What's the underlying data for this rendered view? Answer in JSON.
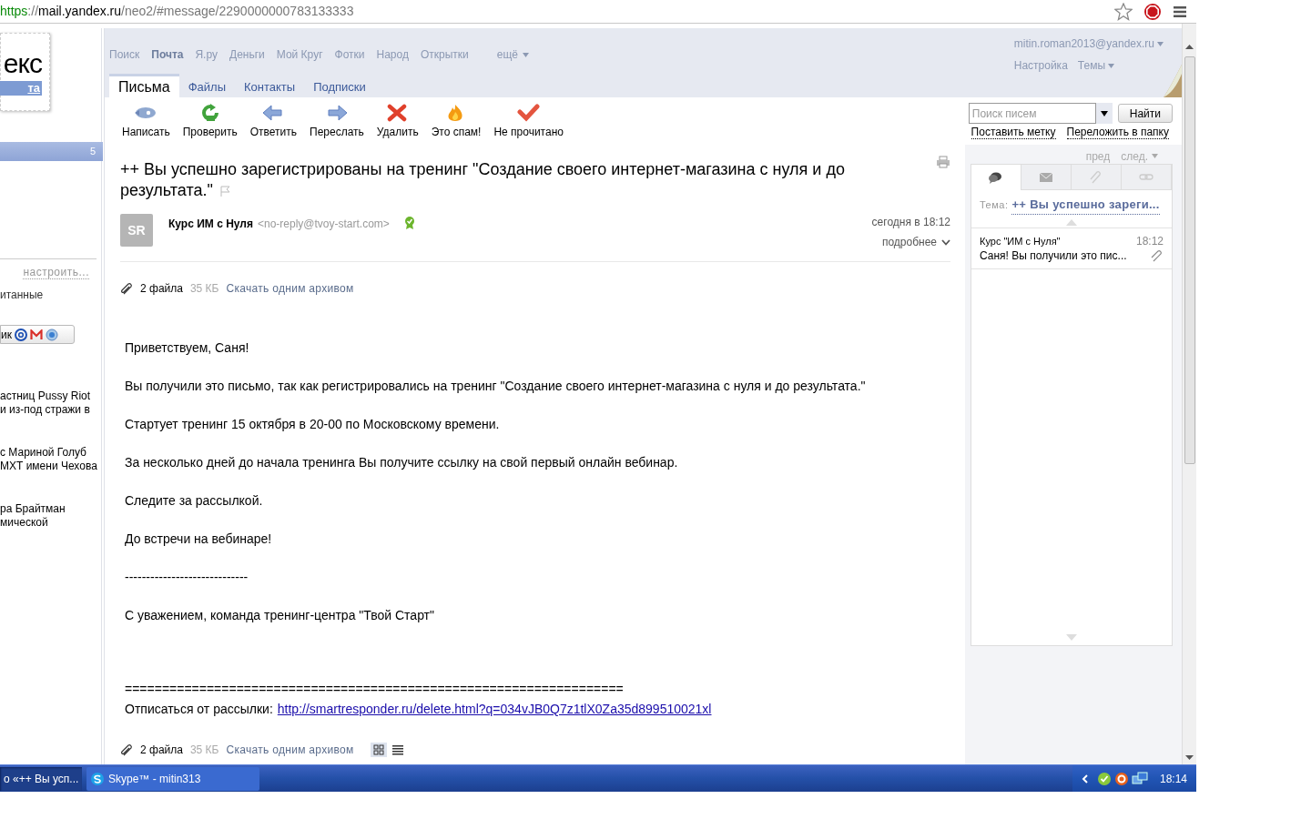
{
  "browser": {
    "url_parts": [
      {
        "kind": "scheme",
        "text": "https"
      },
      {
        "kind": "dim",
        "text": "://"
      },
      {
        "kind": "host",
        "text": "mail.yandex.ru"
      },
      {
        "kind": "dim",
        "text": "/neo2/#message/2290000000783133333"
      }
    ]
  },
  "sidebar": {
    "logo_text": "екс",
    "logo_sub": "та",
    "folder_count": "5",
    "configure_link": "настроить...",
    "folder_item": "итанные",
    "import_button": "ик",
    "news": [
      {
        "lines": [
          "астниц Pussy Riot",
          "и из-под стражи в"
        ]
      },
      {
        "lines": [
          "с Мариной Голуб",
          "МХТ имени Чехова"
        ]
      },
      {
        "lines": [
          "ра Брайтман",
          "мической"
        ]
      }
    ]
  },
  "services": [
    {
      "label": "Поиск",
      "selected": false
    },
    {
      "label": "Почта",
      "selected": true
    },
    {
      "label": "Я.ру",
      "selected": false
    },
    {
      "label": "Деньги",
      "selected": false
    },
    {
      "label": "Мой Круг",
      "selected": false
    },
    {
      "label": "Фотки",
      "selected": false
    },
    {
      "label": "Народ",
      "selected": false
    },
    {
      "label": "Открытки",
      "selected": false
    }
  ],
  "more": "ещё",
  "account": {
    "email": "mitin.roman2013@yandex.ru",
    "settings": "Настройка",
    "themes": "Темы"
  },
  "tabs": [
    {
      "label": "Письма",
      "selected": true
    },
    {
      "label": "Файлы",
      "selected": false
    },
    {
      "label": "Контакты",
      "selected": false
    },
    {
      "label": "Подписки",
      "selected": false
    }
  ],
  "toolbar": [
    {
      "kind": "compose",
      "label": "Написать"
    },
    {
      "kind": "check",
      "label": "Проверить"
    },
    {
      "kind": "reply",
      "label": "Ответить"
    },
    {
      "kind": "forward",
      "label": "Переслать"
    },
    {
      "kind": "delete",
      "label": "Удалить"
    },
    {
      "kind": "spam",
      "label": "Это спам!"
    },
    {
      "kind": "unread",
      "label": "Не прочитано"
    }
  ],
  "search": {
    "placeholder": "Поиск писем",
    "button": "Найти",
    "links": [
      "Поставить метку",
      "Переложить в папку"
    ]
  },
  "message": {
    "subject": "++ Вы успешно зарегистрированы на тренинг \"Создание своего интернет-магазина с нуля и до результата.\"",
    "avatar": "SR",
    "sender_name": "Курс ИМ с Нуля",
    "sender_email": "<no-reply@tvoy-start.com>",
    "date": "сегодня в 18:12",
    "details": "подробнее",
    "attachments_top": {
      "count": "2 файла",
      "size": "35 КБ",
      "download": "Скачать одним архивом"
    },
    "body": [
      {
        "kind": "text",
        "text": "Приветствуем, Саня!"
      },
      {
        "kind": "text",
        "text": "Вы получили это письмо, так как регистрировались на тренинг \"Создание своего интернет-магазина с нуля и до результата.\""
      },
      {
        "kind": "text",
        "text": "Стартует тренинг 15 октября в 20-00 по Московскому времени."
      },
      {
        "kind": "text",
        "text": "За несколько дней до начала тренинга Вы получите ссылку на свой первый онлайн вебинар."
      },
      {
        "kind": "text",
        "text": "Следите за рассылкой."
      },
      {
        "kind": "text",
        "text": "До встречи на вебинаре!"
      },
      {
        "kind": "text",
        "text": "-----------------------------"
      },
      {
        "kind": "text",
        "text": "С уважением, команда тренинг-центра \"Твой Старт\""
      },
      {
        "kind": "gap"
      },
      {
        "kind": "text",
        "text": "==================================================================="
      },
      {
        "kind": "link",
        "label": "Отписаться от рассылки:",
        "url": "http://smartresponder.ru/delete.html?q=034vJB0Q7z1tlX0Za35d899510021xl"
      }
    ],
    "attachments_bottom": {
      "count": "2 файла",
      "size": "35 КБ",
      "download": "Скачать одним архивом"
    }
  },
  "thread_panel": {
    "prev": "пред",
    "next": "след.",
    "tabs": [
      {
        "kind": "conversation",
        "selected": true
      },
      {
        "kind": "mail",
        "selected": false
      },
      {
        "kind": "attachment",
        "selected": false
      },
      {
        "kind": "link",
        "selected": false
      }
    ],
    "topic_label": "Тема:",
    "topic": "++ Вы успешно зареги...",
    "items": [
      {
        "sender": "Курс \"ИМ с Нуля\"",
        "time": "18:12",
        "snippet": "Саня! Вы получили это пис...",
        "selected": true
      }
    ]
  },
  "taskbar": {
    "windows": [
      {
        "kind": "browser",
        "label": "о «++ Вы усп...",
        "selected": true
      },
      {
        "kind": "skype",
        "label": "Skype™ - mitin313",
        "selected": false
      }
    ],
    "clock": "18:14"
  }
}
